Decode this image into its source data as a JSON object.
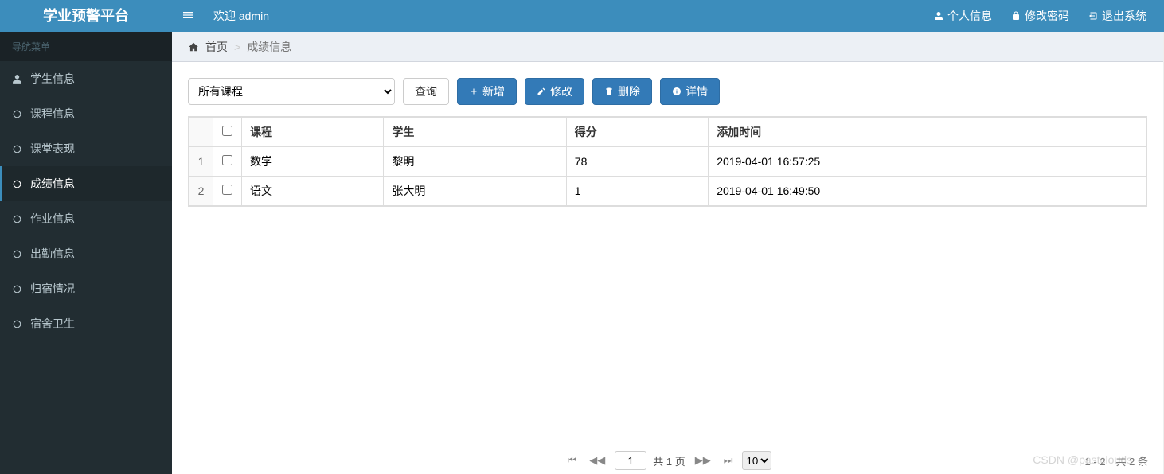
{
  "brand": "学业预警平台",
  "welcome_prefix": "欢迎",
  "username": "admin",
  "top_links": {
    "profile": "个人信息",
    "password": "修改密码",
    "logout": "退出系统"
  },
  "nav_header": "导航菜单",
  "nav": [
    {
      "label": "学生信息",
      "icon": "user",
      "active": false
    },
    {
      "label": "课程信息",
      "icon": "circle",
      "active": false
    },
    {
      "label": "课堂表现",
      "icon": "circle",
      "active": false
    },
    {
      "label": "成绩信息",
      "icon": "circle",
      "active": true
    },
    {
      "label": "作业信息",
      "icon": "circle",
      "active": false
    },
    {
      "label": "出勤信息",
      "icon": "circle",
      "active": false
    },
    {
      "label": "归宿情况",
      "icon": "circle",
      "active": false
    },
    {
      "label": "宿舍卫生",
      "icon": "circle",
      "active": false
    }
  ],
  "breadcrumb": {
    "home": "首页",
    "current": "成绩信息"
  },
  "toolbar": {
    "course_selected": "所有课程",
    "search": "查询",
    "add": "新增",
    "edit": "修改",
    "delete": "删除",
    "detail": "详情"
  },
  "table": {
    "headers": {
      "course": "课程",
      "student": "学生",
      "score": "得分",
      "time": "添加时间"
    },
    "rows": [
      {
        "idx": "1",
        "course": "数学",
        "student": "黎明",
        "score": "78",
        "time": "2019-04-01 16:57:25"
      },
      {
        "idx": "2",
        "course": "语文",
        "student": "张大明",
        "score": "1",
        "time": "2019-04-01 16:49:50"
      }
    ]
  },
  "pager": {
    "current_page": "1",
    "total_pages_text": "共 1 页",
    "page_size": "10",
    "records_text": "1 - 2　共 2 条"
  },
  "watermark": "CSDN @pastclouds"
}
